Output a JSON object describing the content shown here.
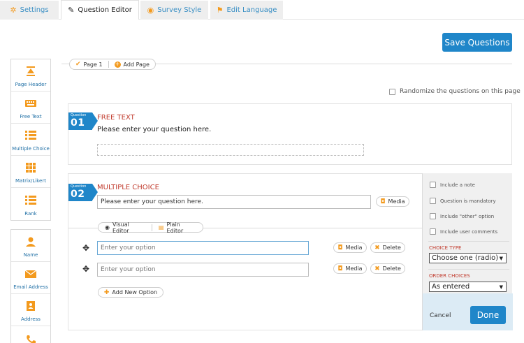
{
  "tabs": [
    {
      "label": "Settings",
      "icon": "gear-icon"
    },
    {
      "label": "Question Editor",
      "icon": "pencil-icon"
    },
    {
      "label": "Survey Style",
      "icon": "eye-icon"
    },
    {
      "label": "Edit Language",
      "icon": "flag-icon"
    }
  ],
  "toolbar": {
    "save_label": "Save Questions"
  },
  "pages": {
    "page_label": "Page 1",
    "add_label": "Add Page"
  },
  "sidebar": {
    "group1": [
      {
        "label": "Page Header",
        "icon": "page-header-icon"
      },
      {
        "label": "Free Text",
        "icon": "keyboard-icon"
      },
      {
        "label": "Multiple Choice",
        "icon": "list-icon"
      },
      {
        "label": "Matrix/Likert",
        "icon": "grid-icon"
      },
      {
        "label": "Rank",
        "icon": "rank-icon"
      }
    ],
    "group2": [
      {
        "label": "Name",
        "icon": "user-icon"
      },
      {
        "label": "Email Address",
        "icon": "envelope-icon"
      },
      {
        "label": "Address",
        "icon": "address-book-icon"
      },
      {
        "label": "",
        "icon": "phone-icon"
      }
    ]
  },
  "randomize_label": "Randomize the questions on this page",
  "question1": {
    "flag_small": "Question",
    "number": "01",
    "type": "FREE TEXT",
    "text": "Please enter your question here."
  },
  "question2": {
    "flag_small": "Question",
    "number": "02",
    "type": "MULTIPLE CHOICE",
    "text_value": "Please enter your question here.",
    "media_label": "Media",
    "visual_editor_label": "Visual Editor",
    "plain_editor_label": "Plain Editor",
    "options": [
      {
        "placeholder": "Enter your option",
        "media": "Media",
        "delete": "Delete"
      },
      {
        "placeholder": "Enter your option",
        "media": "Media",
        "delete": "Delete"
      }
    ],
    "add_option_label": "Add New Option"
  },
  "panel": {
    "checks": [
      "Include a note",
      "Question is mandatory",
      "Include \"other\" option",
      "Include user comments"
    ],
    "choice_type_label": "CHOICE TYPE",
    "choice_type_value": "Choose one (radio)",
    "order_label": "ORDER CHOICES",
    "order_value": "As entered",
    "cancel_label": "Cancel",
    "done_label": "Done"
  },
  "colors": {
    "accent": "#1f86c9",
    "orange": "#f39a1e",
    "type_red": "#c0392b"
  }
}
